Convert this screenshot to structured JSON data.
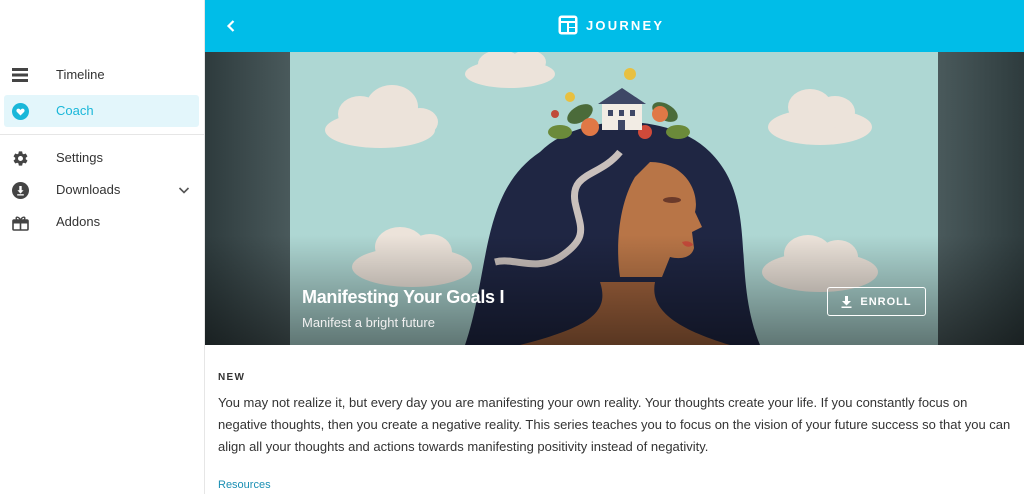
{
  "sidebar": {
    "items": [
      {
        "label": "Timeline",
        "icon": "timeline-icon",
        "active": false
      },
      {
        "label": "Coach",
        "icon": "heart-icon",
        "active": true
      },
      {
        "label": "Settings",
        "icon": "gear-icon",
        "active": false
      },
      {
        "label": "Downloads",
        "icon": "download-icon",
        "active": false
      },
      {
        "label": "Addons",
        "icon": "gift-icon",
        "active": false
      }
    ]
  },
  "header": {
    "brand": "JOURNEY",
    "accent_color": "#00bde8"
  },
  "hero": {
    "title": "Manifesting Your Goals I",
    "subtitle": "Manifest a bright future",
    "enroll_label": "ENROLL"
  },
  "content": {
    "badge": "NEW",
    "description": "You may not realize it, but every day you are manifesting your own reality. Your thoughts create your life. If you constantly focus on negative thoughts, then you create a negative reality. This series teaches you to focus on the vision of your future success so that you can align all your thoughts and actions towards manifesting positivity instead of negativity.",
    "resources_label": "Resources"
  }
}
